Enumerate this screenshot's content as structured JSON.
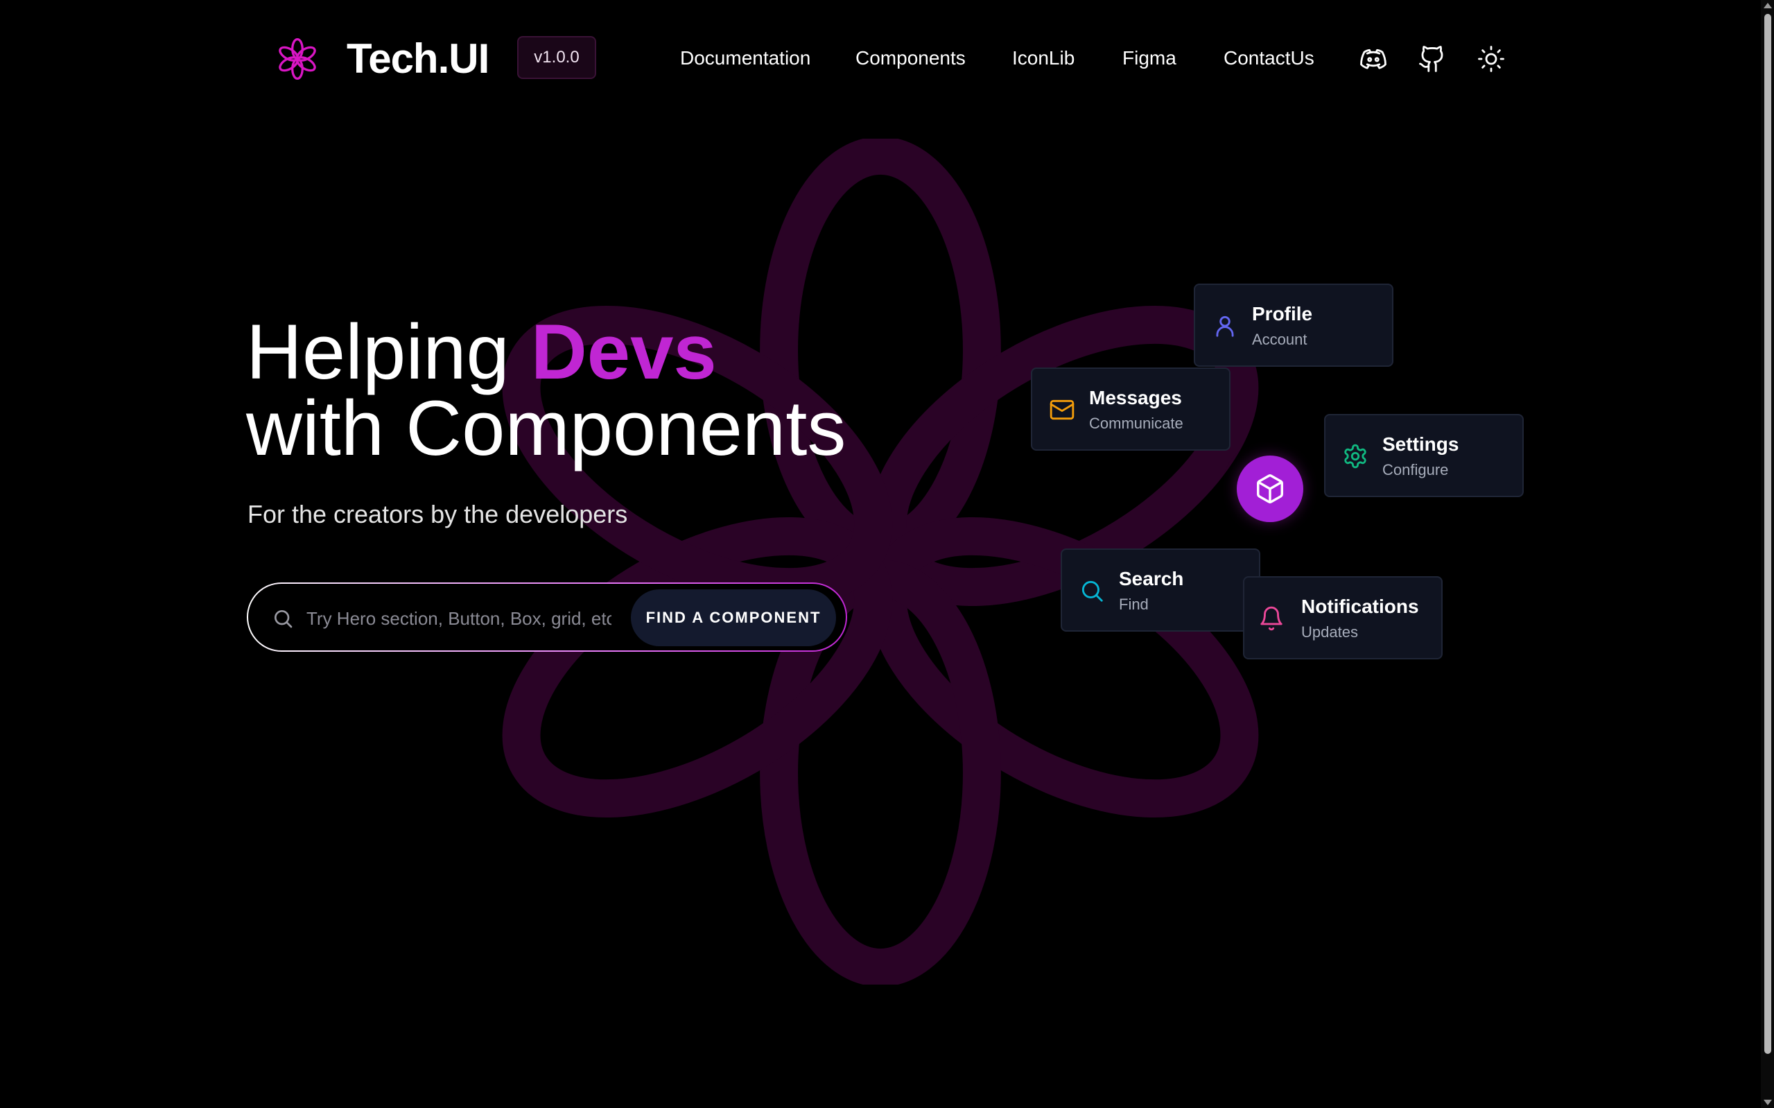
{
  "header": {
    "brand": "Tech.UI",
    "version": "v1.0.0",
    "nav": [
      {
        "label": "Documentation"
      },
      {
        "label": "Components"
      },
      {
        "label": "IconLib"
      },
      {
        "label": "Figma"
      },
      {
        "label": "ContactUs"
      }
    ],
    "icons": [
      "discord-icon",
      "github-icon",
      "sun-icon"
    ]
  },
  "hero": {
    "title_prefix": "Helping ",
    "title_accent": "Devs",
    "title_line2": "with Components",
    "tagline": "For the creators by the developers"
  },
  "search": {
    "placeholder": "Try Hero section, Button, Box, grid, etc..",
    "value": "",
    "button_label": "FIND A COMPONENT"
  },
  "cards": [
    {
      "title": "Profile",
      "subtitle": "Account",
      "icon": "user-icon",
      "color": "#6366f1"
    },
    {
      "title": "Messages",
      "subtitle": "Communicate",
      "icon": "mail-icon",
      "color": "#f59e0b"
    },
    {
      "title": "Settings",
      "subtitle": "Configure",
      "icon": "gear-icon",
      "color": "#10b981"
    },
    {
      "title": "Search",
      "subtitle": "Find",
      "icon": "search-icon",
      "color": "#06b6d4"
    },
    {
      "title": "Notifications",
      "subtitle": "Updates",
      "icon": "bell-icon",
      "color": "#ec4899"
    }
  ],
  "center_icon": "cube-icon",
  "colors": {
    "accent": "#c026d3",
    "background": "#000000",
    "card_bg": "#0f1320",
    "watermark": "#2a0326"
  }
}
